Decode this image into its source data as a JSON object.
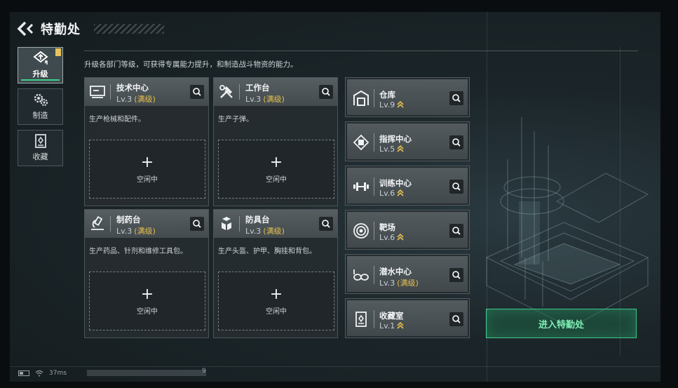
{
  "header": {
    "title": "特勤处"
  },
  "side_tabs": [
    {
      "label": "升级",
      "icon": "upgrade-icon"
    },
    {
      "label": "制造",
      "icon": "gears-icon"
    },
    {
      "label": "收藏",
      "icon": "collection-icon"
    }
  ],
  "intro": "升级各部门等级，可获得专属能力提升，和制造战斗物资的能力。",
  "facilities": [
    {
      "name": "技术中心",
      "level": "Lv.3",
      "max_label": "(满级)",
      "desc": "生产枪械和配件。",
      "slot_label": "空闲中",
      "icon": "tech-center-icon"
    },
    {
      "name": "工作台",
      "level": "Lv.3",
      "max_label": "(满级)",
      "desc": "生产子弹。",
      "slot_label": "空闲中",
      "icon": "workbench-icon"
    },
    {
      "name": "制药台",
      "level": "Lv.3",
      "max_label": "(满级)",
      "desc": "生产药品、针剂和维修工具包。",
      "slot_label": "空闲中",
      "icon": "pharmacy-icon"
    },
    {
      "name": "防具台",
      "level": "Lv.3",
      "max_label": "(满级)",
      "desc": "生产头盔、护甲、胸挂和背包。",
      "slot_label": "空闲中",
      "icon": "armor-bench-icon"
    }
  ],
  "buildings": [
    {
      "name": "仓库",
      "level": "Lv.9",
      "icon": "warehouse-icon"
    },
    {
      "name": "指挥中心",
      "level": "Lv.5",
      "icon": "command-center-icon"
    },
    {
      "name": "训练中心",
      "level": "Lv.6",
      "icon": "training-center-icon"
    },
    {
      "name": "靶场",
      "level": "Lv.6",
      "icon": "shooting-range-icon"
    },
    {
      "name": "潜水中心",
      "level": "Lv.3",
      "max_label": "(满级)",
      "icon": "diving-center-icon"
    },
    {
      "name": "收藏室",
      "level": "Lv.1",
      "icon": "collection-room-icon"
    }
  ],
  "enter_button": "进入特勤处",
  "status": {
    "ping": "37ms",
    "num": "9"
  },
  "colors": {
    "accent_green": "#3fc98a",
    "max_gold": "#e7bf4e"
  }
}
